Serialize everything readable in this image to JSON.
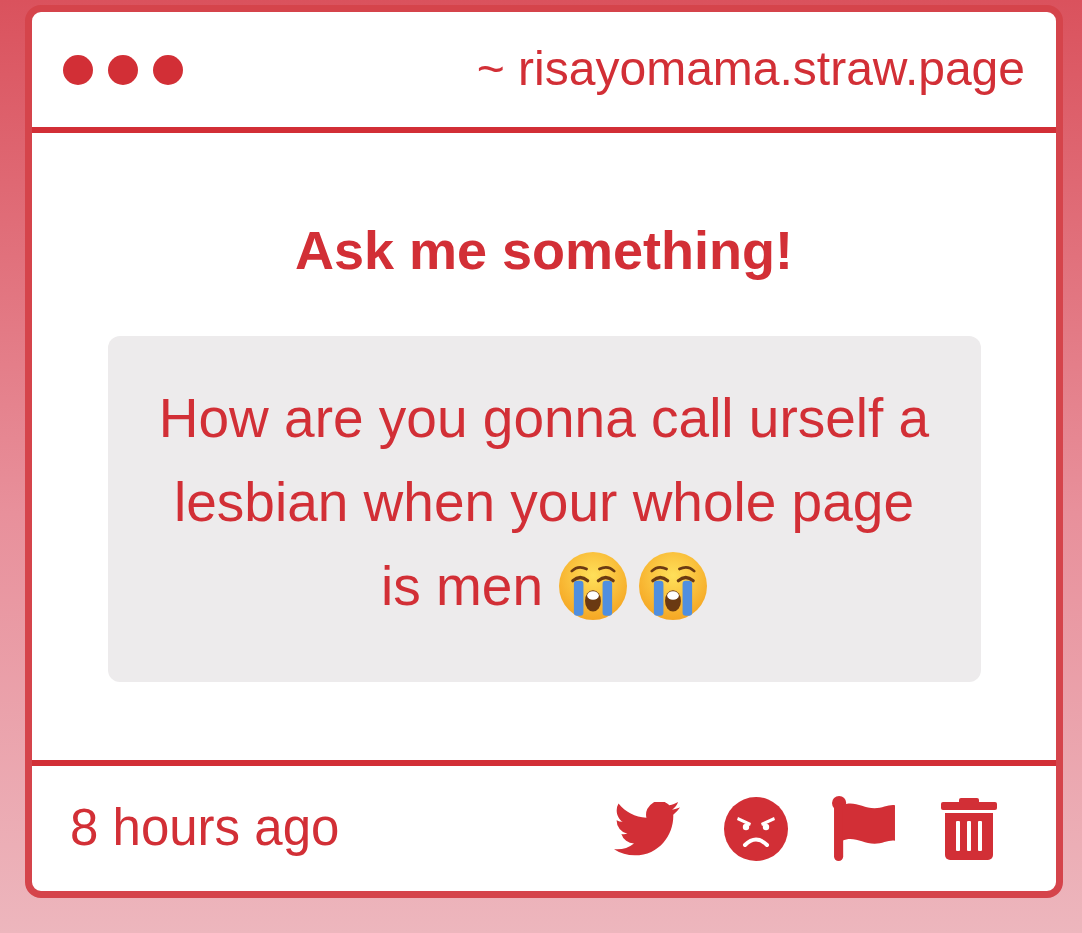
{
  "window": {
    "url": "~ risayomama.straw.page"
  },
  "title": "Ask me something!",
  "question": {
    "text": "How are you gonna call urself a lesbian when your whole page",
    "last_line": "is men"
  },
  "footer": {
    "time": "8 hours ago"
  }
}
